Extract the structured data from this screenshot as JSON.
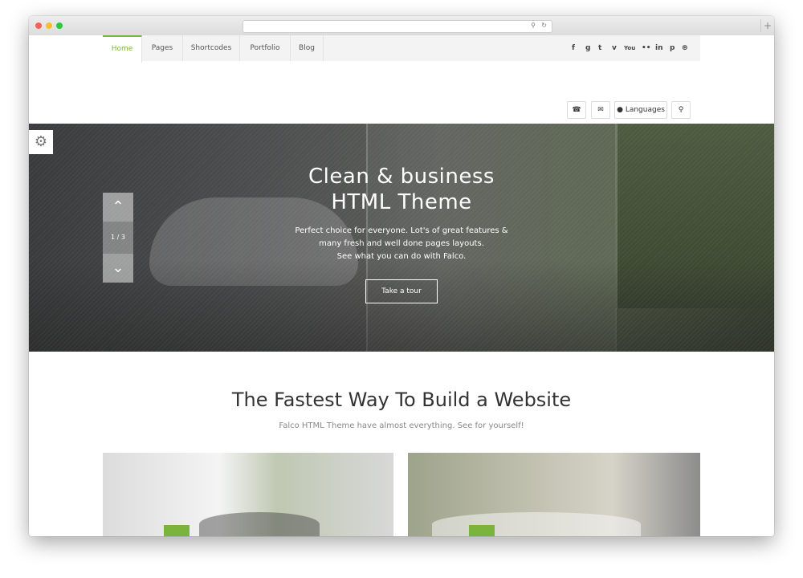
{
  "browser": {
    "search_icon": "search-icon",
    "reload_icon": "reload-icon",
    "newtab_symbol": "+"
  },
  "nav": {
    "items": [
      {
        "label": "Home",
        "active": true
      },
      {
        "label": "Pages"
      },
      {
        "label": "Shortcodes"
      },
      {
        "label": "Portfolio"
      },
      {
        "label": "Blog"
      }
    ],
    "social": [
      {
        "icon": "facebook-icon",
        "glyph": "f"
      },
      {
        "icon": "google-icon",
        "glyph": "g"
      },
      {
        "icon": "twitter-icon",
        "glyph": "t"
      },
      {
        "icon": "vimeo-icon",
        "glyph": "v"
      },
      {
        "icon": "youtube-icon",
        "glyph": "You"
      },
      {
        "icon": "flickr-icon",
        "glyph": "••"
      },
      {
        "icon": "linkedin-icon",
        "glyph": "in"
      },
      {
        "icon": "pinterest-icon",
        "glyph": "p"
      },
      {
        "icon": "dribbble-icon",
        "glyph": "⊛"
      }
    ]
  },
  "utility": {
    "phone_icon": "phone-icon",
    "mail_icon": "mail-icon",
    "languages_label": "Languages",
    "search_icon": "search-icon"
  },
  "hero": {
    "title_line1": "Clean & business",
    "title_line2": "HTML Theme",
    "text_line1": "Perfect choice for everyone. Lot's of great features &",
    "text_line2": "many fresh and well done pages layouts.",
    "text_line3": "See what you can do with Falco.",
    "button_label": "Take a tour",
    "slide_counter": "1 / 3"
  },
  "section": {
    "title": "The Fastest Way To Build a Website",
    "subtitle": "Falco HTML Theme have almost everything. See for yourself!"
  },
  "colors": {
    "accent": "#7ab43c"
  }
}
